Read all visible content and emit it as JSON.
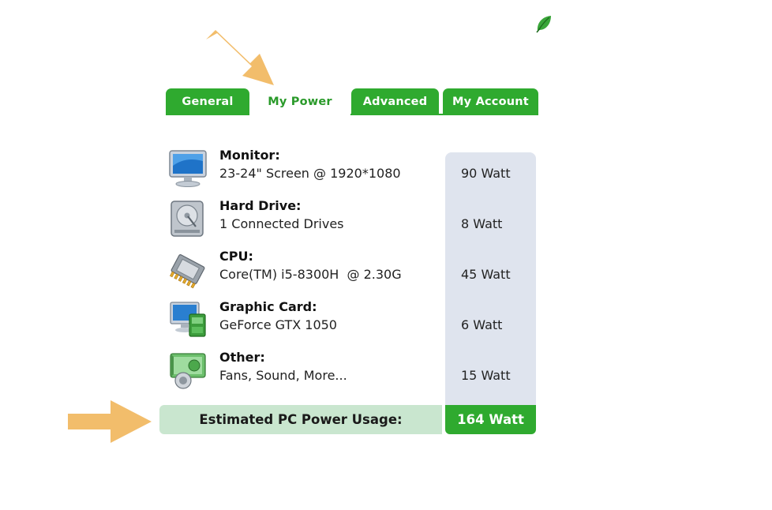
{
  "brand": {
    "logo_icon": "leaf-icon",
    "accent_color": "#2faa2f",
    "annotation_color": "#f2bd6b"
  },
  "tabs": [
    {
      "label": "General",
      "active": false
    },
    {
      "label": "My Power",
      "active": true
    },
    {
      "label": "Advanced",
      "active": false
    },
    {
      "label": "My Account",
      "active": false
    }
  ],
  "components": [
    {
      "title": "Monitor:",
      "detail": "23-24\" Screen @ 1920*1080",
      "watt": "90 Watt",
      "icon": "monitor-icon"
    },
    {
      "title": "Hard Drive:",
      "detail": "1 Connected Drives",
      "watt": "8 Watt",
      "icon": "hard-drive-icon"
    },
    {
      "title": "CPU:",
      "detail": "Core(TM) i5-8300H  @ 2.30G",
      "watt": "45 Watt",
      "icon": "cpu-icon"
    },
    {
      "title": "Graphic Card:",
      "detail": "GeForce GTX 1050",
      "watt": "6 Watt",
      "icon": "graphic-card-icon"
    },
    {
      "title": "Other:",
      "detail": "Fans, Sound, More...",
      "watt": "15 Watt",
      "icon": "speaker-icon"
    }
  ],
  "total": {
    "label": "Estimated PC Power Usage:",
    "value": "164 Watt"
  }
}
